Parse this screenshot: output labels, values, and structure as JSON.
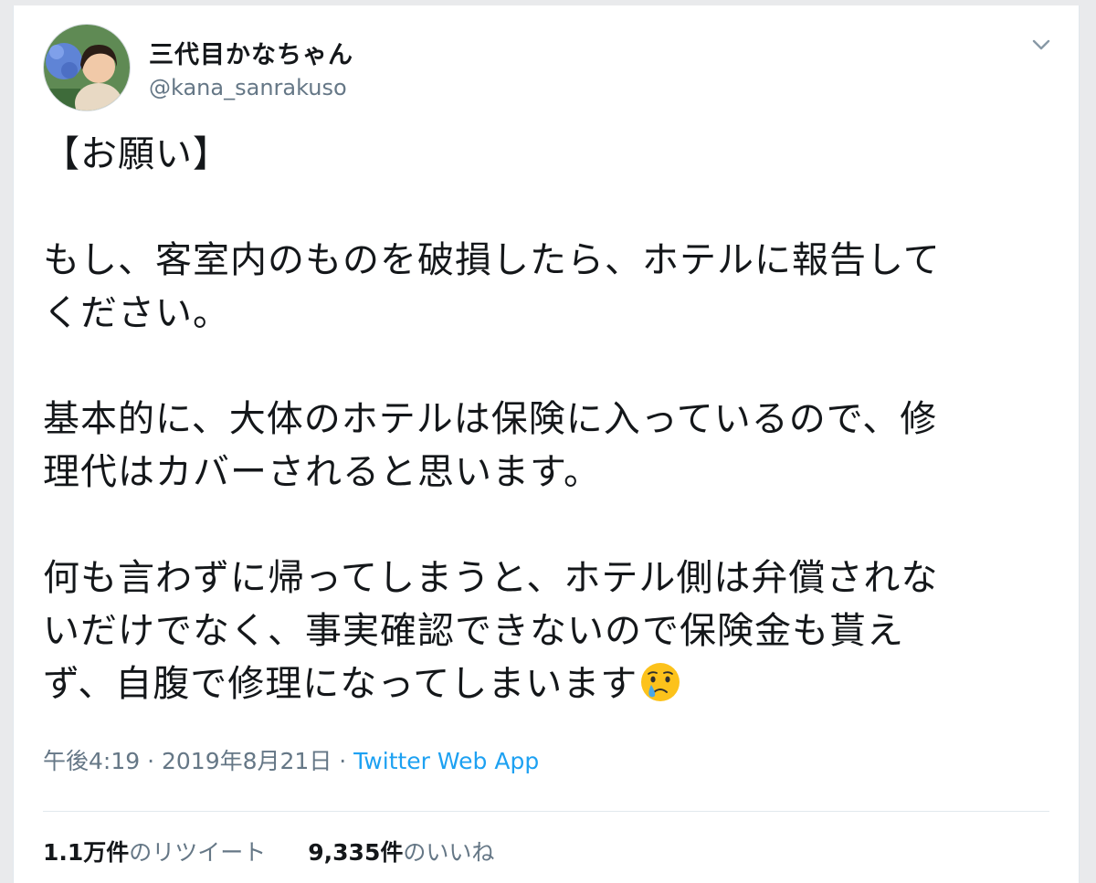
{
  "tweet": {
    "author": {
      "display_name": "三代目かなちゃん",
      "handle": "@kana_sanrakuso"
    },
    "menu_icon": "chevron-down-icon",
    "body": {
      "heading": "【お願い】",
      "p1_line1": "もし、客室内のものを破損したら、ホテルに報告して",
      "p1_line2": "ください。",
      "p2_line1": "基本的に、大体のホテルは保険に入っているので、修",
      "p2_line2": "理代はカバーされると思います。",
      "p3_line1": "何も言わずに帰ってしまうと、ホテル側は弁償されな",
      "p3_line2": "いだけでなく、事実確認できないので保険金も貰え",
      "p3_line3": "ず、自腹で修理になってしまいます",
      "emoji": "crying-face-icon"
    },
    "meta": {
      "time": "午後4:19",
      "separator": " · ",
      "date": "2019年8月21日",
      "source": "Twitter Web App"
    },
    "stats": {
      "retweets_count": "1.1万件",
      "retweets_label": "のリツイート",
      "likes_count": "9,335件",
      "likes_label": "のいいね"
    },
    "colors": {
      "text": "#14171a",
      "secondary": "#657786",
      "link": "#1da1f2"
    }
  }
}
